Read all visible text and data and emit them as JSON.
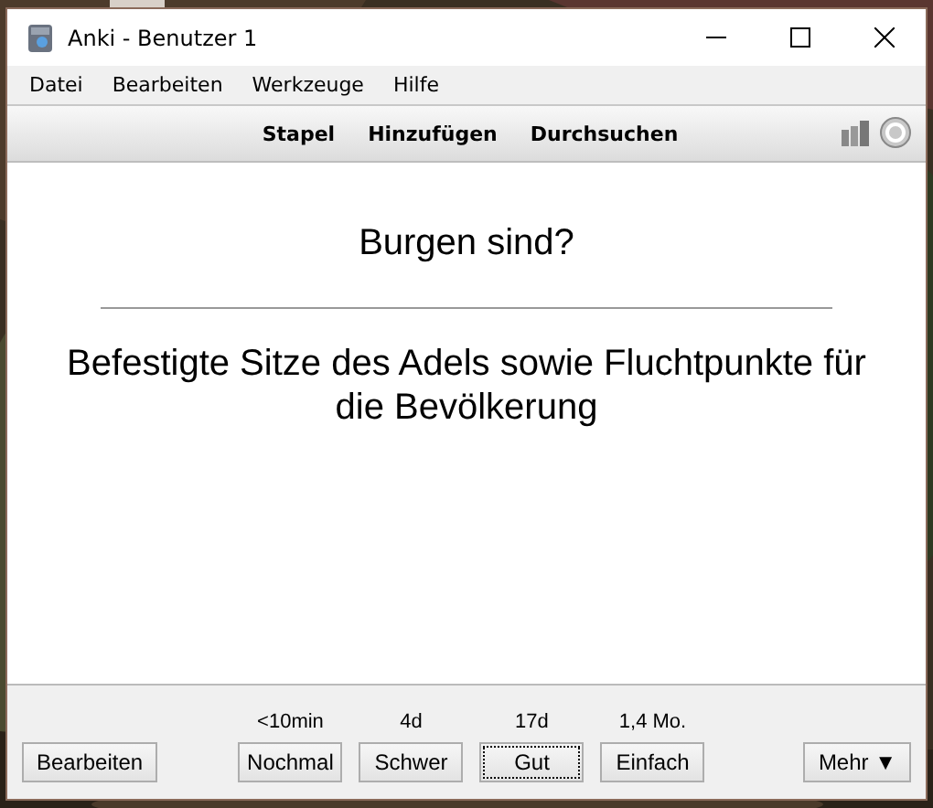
{
  "window": {
    "title": "Anki - Benutzer 1"
  },
  "menu": [
    "Datei",
    "Bearbeiten",
    "Werkzeuge",
    "Hilfe"
  ],
  "toolbar": [
    "Stapel",
    "Hinzufügen",
    "Durchsuchen"
  ],
  "card": {
    "question": "Burgen sind?",
    "answer": "Befestigte Sitze des Adels sowie Fluchtpunkte für die Bevölkerung"
  },
  "bottom": {
    "edit_button": "Bearbeiten",
    "answers": [
      {
        "interval": "<10min",
        "label": "Nochmal",
        "focused": false
      },
      {
        "interval": "4d",
        "label": "Schwer",
        "focused": false
      },
      {
        "interval": "17d",
        "label": "Gut",
        "focused": true
      },
      {
        "interval": "1,4 Mo.",
        "label": "Einfach",
        "focused": false
      }
    ],
    "more_button": "Mehr ▼"
  }
}
